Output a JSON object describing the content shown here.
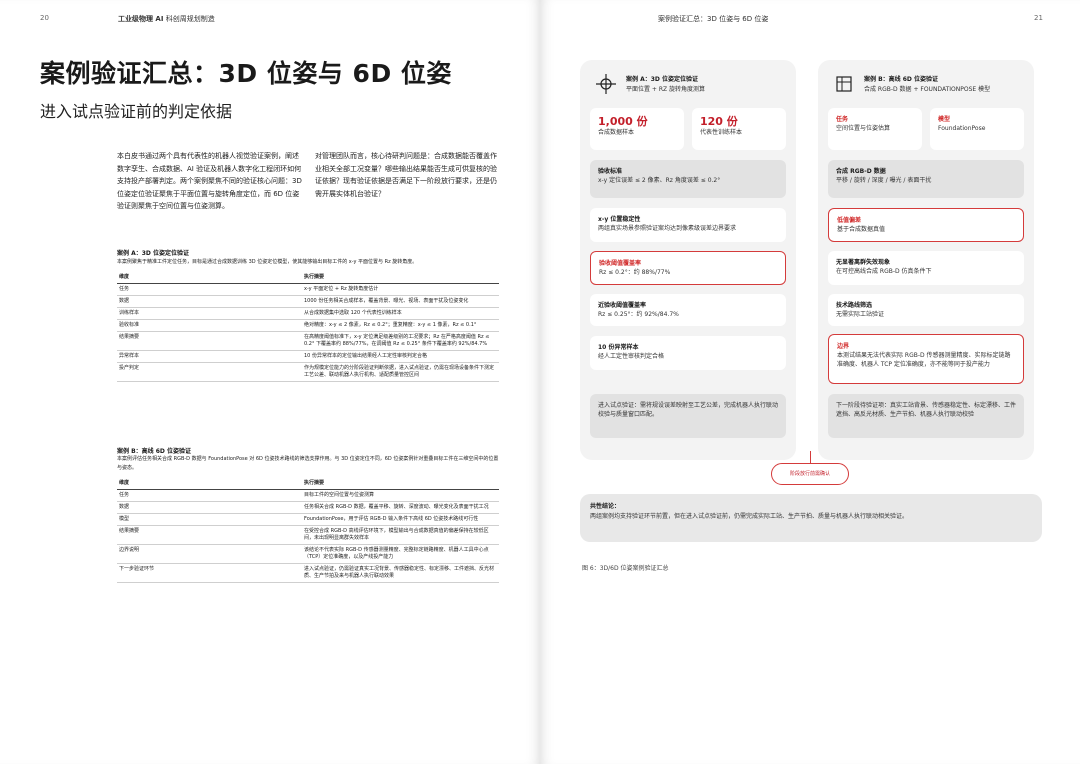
{
  "header": {
    "left_page_num": "20",
    "left_title_bold": "工业级物理 AI",
    "left_title_rest": " 科创周规划制造",
    "right_title": "案例验证汇总：3D 位姿与 6D 位姿",
    "right_page_num": "21"
  },
  "title": "案例验证汇总：3D 位姿与 6D 位姿",
  "subtitle": "进入试点验证前的判定依据",
  "intro": {
    "col1": "本白皮书通过两个具有代表性的机器人视觉验证案例，阐述数字孪生、合成数据、AI 验证及机器人数字化工程闭环如何支持投产部署判定。两个案例聚焦不同的验证核心问题：3D 位姿定位验证聚焦于平面位置与旋转角度定位，而 6D 位姿验证则聚焦于空间位置与位姿测算。",
    "col2": "对管理团队而言，核心待研判问题是：合成数据能否覆盖作业相关全部工况变量？哪些输出结果能否生成可供复核的验证依据？现有验证依据是否满足下一阶段放行要求，还是仍需开展实体机台验证？"
  },
  "section_a": {
    "title": "案例 A：3D 位姿定位验证",
    "desc": "本案例聚焦于精准工件定位任务，目标是通过合成数据训练 3D 位姿定位模型，使其能够输出目标工件的 x-y 平面位置与 Rz 旋转角度。",
    "headers": [
      "维度",
      "执行摘要"
    ],
    "rows": [
      [
        "任务",
        "x-y 平面定位 + Rz 旋转角度估计"
      ],
      [
        "数据",
        "1000 份任务相关合成样本，覆盖背景、曝光、视场、表面干扰及位姿变化"
      ],
      [
        "训练样本",
        "从合成数据集中选取 120 个代表性训练样本"
      ],
      [
        "验收标准",
        "绝对精度：x-y ≤ 2 像素，Rz ≤ 0.2°；重复精度：x-y ≤ 1 像素，Rz ≤ 0.1°"
      ],
      [
        "结果摘要",
        "在高精度阈值标准下，x-y 定位满足级差级别的工况要求；Rz 在严格高度阈值 Rz ≤ 0.2° 下覆盖率约 88%/77%，在调阈值 Rz ≤ 0.25° 条件下覆盖率约 92%/84.7%"
      ],
      [
        "异常样本",
        "10 份异常样本的定位输出结果经人工定性审核判定合格"
      ],
      [
        "投产判定",
        "作为规模定位能力的分阶段验证判断依据，进入试点验证，仍需在现场设备条件下测定工艺公差、联动机器人执行机构、适配质量管控区间"
      ]
    ]
  },
  "section_b": {
    "title": "案例 B：高线 6D 位姿验证",
    "desc": "本案例评估任务相关合成 RGB-D 数据与 FoundationPose 对 6D 位姿技术路线的筛选支撑作用。与 3D 位姿定位不同，6D 位姿案例针对重叠目标工件在三维空间中的位置与姿态。",
    "headers": [
      "维度",
      "执行摘要"
    ],
    "rows": [
      [
        "任务",
        "目标工件的空间位置与位姿测算"
      ],
      [
        "数据",
        "任务相关合成 RGB-D 数据，覆盖平移、旋转、深度波动、曝光变化及表面干扰工况"
      ],
      [
        "模型",
        "FoundationPose，用于评估 RGB-D 输入条件下高线 6D 位姿技术路线可行性"
      ],
      [
        "结果摘要",
        "在受控合成 RGB-D 高线评估环境下，模型输出与合成数据真值的偏差保持在较低区间，未出现明显离群失效样本"
      ],
      [
        "边界说明",
        "该结论不代表实际 RGB-D 传感器测量精度、完整标定链路精度、机器人工具中心点（TCP）定位准确度，以及产线投产能力"
      ],
      [
        "下一步验证环节",
        "进入试点验证，仍需验证真实工况背景、传感器稳定性、标定漂移、工件遮挡、反光材质、生产节拍及来与机器人执行联动效果"
      ]
    ]
  },
  "card_a": {
    "title": "案例 A：3D 位姿定位验证",
    "sub": "平面位置 + RZ 旋转角度测算",
    "stat1_value": "1,000 份",
    "stat1_label": "合成数据样本",
    "stat2_value": "120 份",
    "stat2_label": "代表性训练样本",
    "criteria_title": "验收标准",
    "criteria_text": "x-y 定位误差 ≤ 2 像素、Rz 角度误差 ≤ 0.2°",
    "xy_title": "x-y 位置稳定性",
    "xy_text": "两组真实场景参照验证案均达到像素级误差边界要求",
    "strict_title": "验收阈值覆盖率",
    "strict_text": "Rz ≤ 0.2°：约 88%/77%",
    "near_title": "近验收阈值覆盖率",
    "near_text": "Rz ≤ 0.25°：约 92%/84.7%",
    "anomaly_title": "10 份异常样本",
    "anomaly_text": "经人工定性审核判定合格",
    "next_text": "进入试点验证：需将规设误差映射至工艺公差，完成机器人执行联动校验与质量窗口匹配。"
  },
  "card_b": {
    "title": "案例 B：高线 6D 位姿验证",
    "sub": "合成 RGB-D 数据 + FOUNDATIONPOSE 模型",
    "task_title": "任务",
    "task_text": "空间位置与位姿估算",
    "model_title": "模型",
    "model_text": "FoundationPose",
    "data_title": "合成 RGB-D 数据",
    "data_text": "平移 / 旋转 / 深度 / 曝光 / 表面干扰",
    "dev_title": "低值偏差",
    "dev_text": "基于合成数据真值",
    "fail_title": "无显著离群失效现象",
    "fail_text": "在可控高线合成 RGB-D 仿真条件下",
    "route_title": "技术路线筛选",
    "route_text": "无需实际工站验证",
    "bound_title": "边界",
    "bound_text": "本测试结果无法代表实际 RGB-D 传感器测量精度、实际标定链路准确度、机器人 TCP 定位准确度，亦不能等同于投产能力",
    "next_text": "下一阶段待验证项：真实工站背景、传感器稳定性、标定漂移、工件遮挡、高反光材质、生产节拍、机器人执行联动校验"
  },
  "pill_label": "阶段放行前需确认",
  "conclusion": {
    "title": "共性结论：",
    "text": "两组案例均支持验证环节前置，但在进入试点验证前，仍需完成实际工站、生产节拍、质量与机器人执行联动相关验证。"
  },
  "caption": "图 6：3D/6D 位姿案例验证汇总",
  "colors": {
    "accent": "#c31f2a",
    "card_bg": "#f3f3f3",
    "box_grey": "#e2e2e2"
  },
  "icons": {
    "card_a": "crosshair-icon",
    "card_b": "cube-icon"
  }
}
